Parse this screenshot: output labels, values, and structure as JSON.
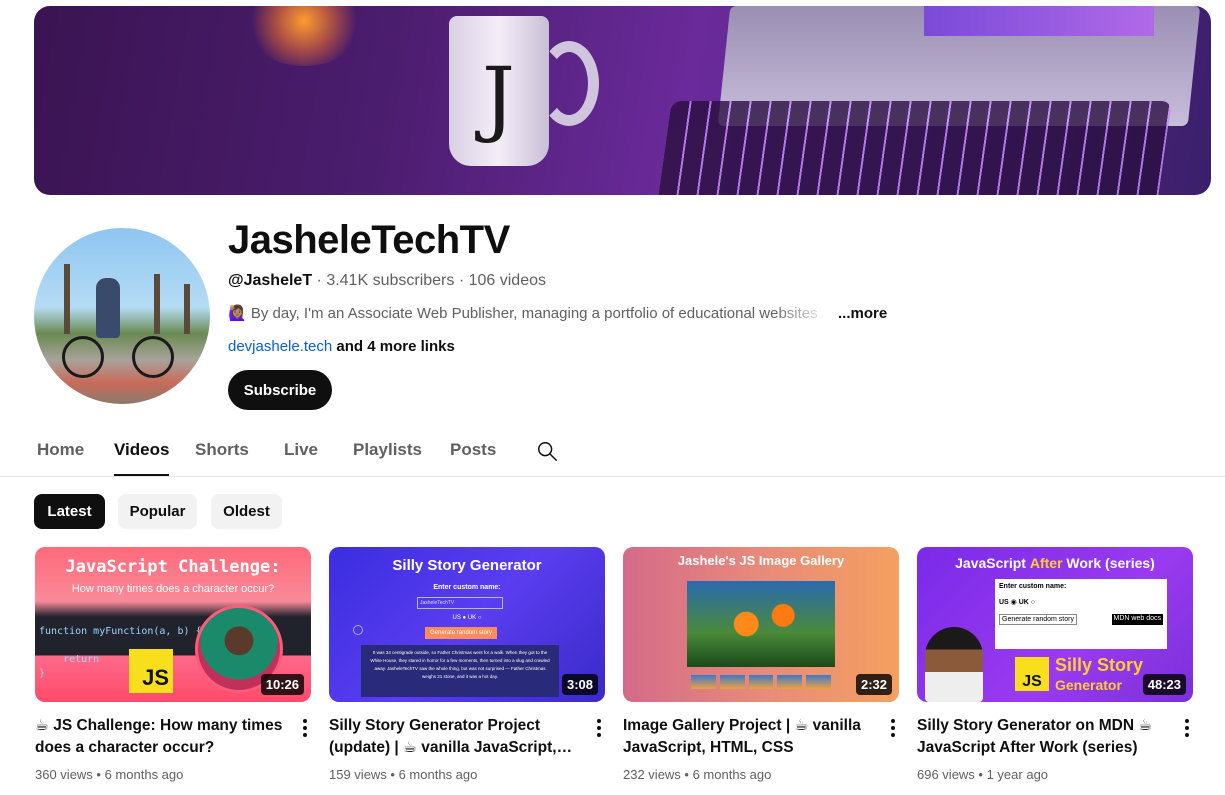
{
  "channel": {
    "name": "JasheleTechTV",
    "handle": "@JasheleT",
    "stats": " · 3.41K subscribers · 106 videos",
    "description": "🙋🏽‍♀️ By day, I'm an Associate Web Publisher, managing a portfolio of educational websites",
    "more": "...more",
    "link": "devjashele.tech",
    "more_links": " and 4 more links",
    "subscribe": "Subscribe"
  },
  "tabs": [
    {
      "label": "Home"
    },
    {
      "label": "Videos"
    },
    {
      "label": "Shorts"
    },
    {
      "label": "Live"
    },
    {
      "label": "Playlists"
    },
    {
      "label": "Posts"
    }
  ],
  "active_tab": "Videos",
  "filters": [
    "Latest",
    "Popular",
    "Oldest"
  ],
  "active_filter": "Latest",
  "videos": [
    {
      "title": "☕ JS Challenge: How many times does a character occur?",
      "views": "360 views",
      "age": "6 months ago",
      "duration": "10:26",
      "thumb": {
        "heading": "JavaScript Challenge:",
        "subheading": "How many times does a character occur?",
        "code": "function myFunction(a, b) {\n\n    return\n}",
        "badge": "JS"
      }
    },
    {
      "title": "Silly Story Generator Project (update) | ☕ vanilla JavaScript, HTML, CSS",
      "views": "159 views",
      "age": "6 months ago",
      "duration": "3:08",
      "thumb": {
        "heading": "Silly Story Generator",
        "label": "Enter custom name:",
        "input": "JasheleTechTV",
        "radios": "US ● UK ○",
        "button": "Generate random story",
        "story": "It was 34 centigrade outside, so Father Christmas went for a walk. When they got to the White House, they stared in horror for a few moments, then turned into a slug and crawled away. JasheleTechTV saw the whole thing, but was not surprised — Father Christmas weighs 21 stone, and it was a hot day."
      }
    },
    {
      "title": "Image Gallery Project | ☕ vanilla JavaScript, HTML, CSS",
      "views": "232 views",
      "age": "6 months ago",
      "duration": "2:32",
      "thumb": {
        "heading": "Jashele's JS Image Gallery"
      }
    },
    {
      "title": "Silly Story Generator on MDN ☕ JavaScript After Work (series)",
      "views": "696 views",
      "age": "1 year ago",
      "duration": "48:23",
      "thumb": {
        "heading_a": "JavaScript ",
        "heading_b": "After",
        "heading_c": " Work (series)",
        "form_label": "Enter custom name:",
        "radios": "US ◉ UK ○",
        "button": "Generate random story",
        "docs": "MDN web docs",
        "badge": "JS",
        "silly": "Silly Story",
        "generator": "Generator"
      }
    }
  ],
  "meta_separator": " • ",
  "colors": {
    "accent": "#065fd4",
    "primary": "#0f0f0f",
    "secondary": "#606060",
    "chip_bg": "#f2f2f2"
  }
}
